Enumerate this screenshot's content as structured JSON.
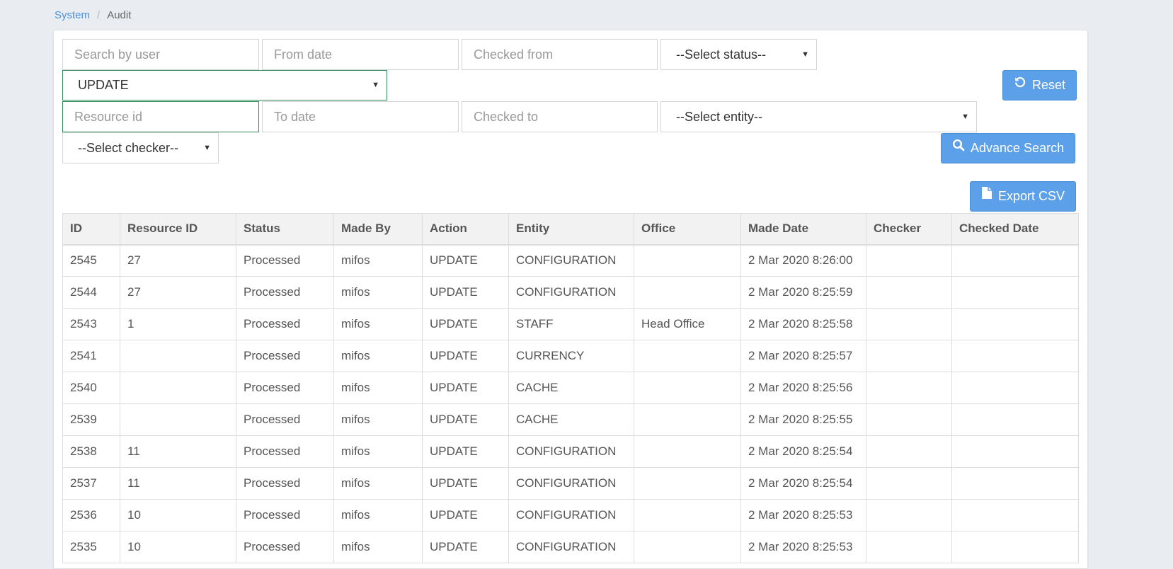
{
  "breadcrumb": {
    "parent": "System",
    "separator": "/",
    "current": "Audit"
  },
  "filters": {
    "search_user_placeholder": "Search by user",
    "from_date_placeholder": "From date",
    "checked_from_placeholder": "Checked from",
    "status_select": "--Select status--",
    "action_select": "UPDATE",
    "resource_id_placeholder": "Resource id",
    "to_date_placeholder": "To date",
    "checked_to_placeholder": "Checked to",
    "entity_select": "--Select entity--",
    "checker_select": "--Select checker--"
  },
  "buttons": {
    "reset": "Reset",
    "advance_search": "Advance Search",
    "export_csv": "Export CSV"
  },
  "icons": {
    "reset": "undo-icon",
    "advance_search": "search-icon",
    "export_csv": "file-icon",
    "dropdown": "caret-down-icon"
  },
  "colors": {
    "primary_button": "#5ba0e8",
    "link": "#4a90d9",
    "focus_border": "#2e8b57"
  },
  "table": {
    "headers": [
      "ID",
      "Resource ID",
      "Status",
      "Made By",
      "Action",
      "Entity",
      "Office",
      "Made Date",
      "Checker",
      "Checked Date"
    ],
    "rows": [
      [
        "2545",
        "27",
        "Processed",
        "mifos",
        "UPDATE",
        "CONFIGURATION",
        "",
        "2 Mar 2020 8:26:00",
        "",
        ""
      ],
      [
        "2544",
        "27",
        "Processed",
        "mifos",
        "UPDATE",
        "CONFIGURATION",
        "",
        "2 Mar 2020 8:25:59",
        "",
        ""
      ],
      [
        "2543",
        "1",
        "Processed",
        "mifos",
        "UPDATE",
        "STAFF",
        "Head Office",
        "2 Mar 2020 8:25:58",
        "",
        ""
      ],
      [
        "2541",
        "",
        "Processed",
        "mifos",
        "UPDATE",
        "CURRENCY",
        "",
        "2 Mar 2020 8:25:57",
        "",
        ""
      ],
      [
        "2540",
        "",
        "Processed",
        "mifos",
        "UPDATE",
        "CACHE",
        "",
        "2 Mar 2020 8:25:56",
        "",
        ""
      ],
      [
        "2539",
        "",
        "Processed",
        "mifos",
        "UPDATE",
        "CACHE",
        "",
        "2 Mar 2020 8:25:55",
        "",
        ""
      ],
      [
        "2538",
        "11",
        "Processed",
        "mifos",
        "UPDATE",
        "CONFIGURATION",
        "",
        "2 Mar 2020 8:25:54",
        "",
        ""
      ],
      [
        "2537",
        "11",
        "Processed",
        "mifos",
        "UPDATE",
        "CONFIGURATION",
        "",
        "2 Mar 2020 8:25:54",
        "",
        ""
      ],
      [
        "2536",
        "10",
        "Processed",
        "mifos",
        "UPDATE",
        "CONFIGURATION",
        "",
        "2 Mar 2020 8:25:53",
        "",
        ""
      ],
      [
        "2535",
        "10",
        "Processed",
        "mifos",
        "UPDATE",
        "CONFIGURATION",
        "",
        "2 Mar 2020 8:25:53",
        "",
        ""
      ]
    ]
  }
}
